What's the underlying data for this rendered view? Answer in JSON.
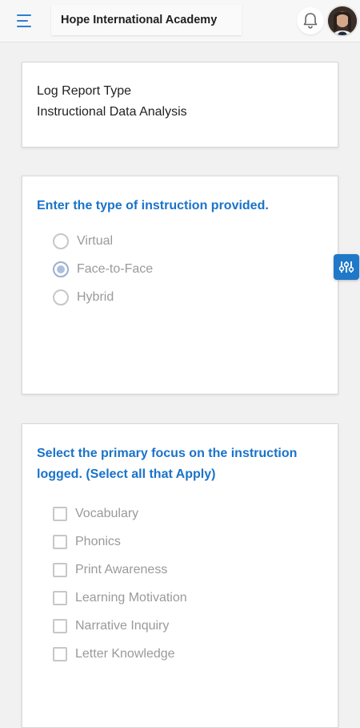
{
  "header": {
    "title": "Hope International Academy",
    "menu_icon": "hamburger-menu-icon",
    "bell_icon": "bell-icon",
    "accent_color": "#2f80d0"
  },
  "log_report": {
    "line1": "Log Report Type",
    "line2": "Instructional Data Analysis"
  },
  "instruction_type": {
    "question": "Enter the type of instruction provided.",
    "options": [
      {
        "label": "Virtual",
        "checked": false
      },
      {
        "label": "Face-to-Face",
        "checked": true
      },
      {
        "label": "Hybrid",
        "checked": false
      }
    ]
  },
  "primary_focus": {
    "question": "Select the primary focus on the instruction logged. (Select all that Apply)",
    "options": [
      {
        "label": "Vocabulary",
        "checked": false
      },
      {
        "label": "Phonics",
        "checked": false
      },
      {
        "label": "Print Awareness",
        "checked": false
      },
      {
        "label": "Learning Motivation",
        "checked": false
      },
      {
        "label": "Narrative Inquiry",
        "checked": false
      },
      {
        "label": "Letter Knowledge",
        "checked": false
      }
    ]
  },
  "floating_button": {
    "icon": "sliders-icon",
    "color": "#1f78c8"
  },
  "colors": {
    "question_text": "#1a73c9",
    "option_text": "#9a9a9a"
  }
}
